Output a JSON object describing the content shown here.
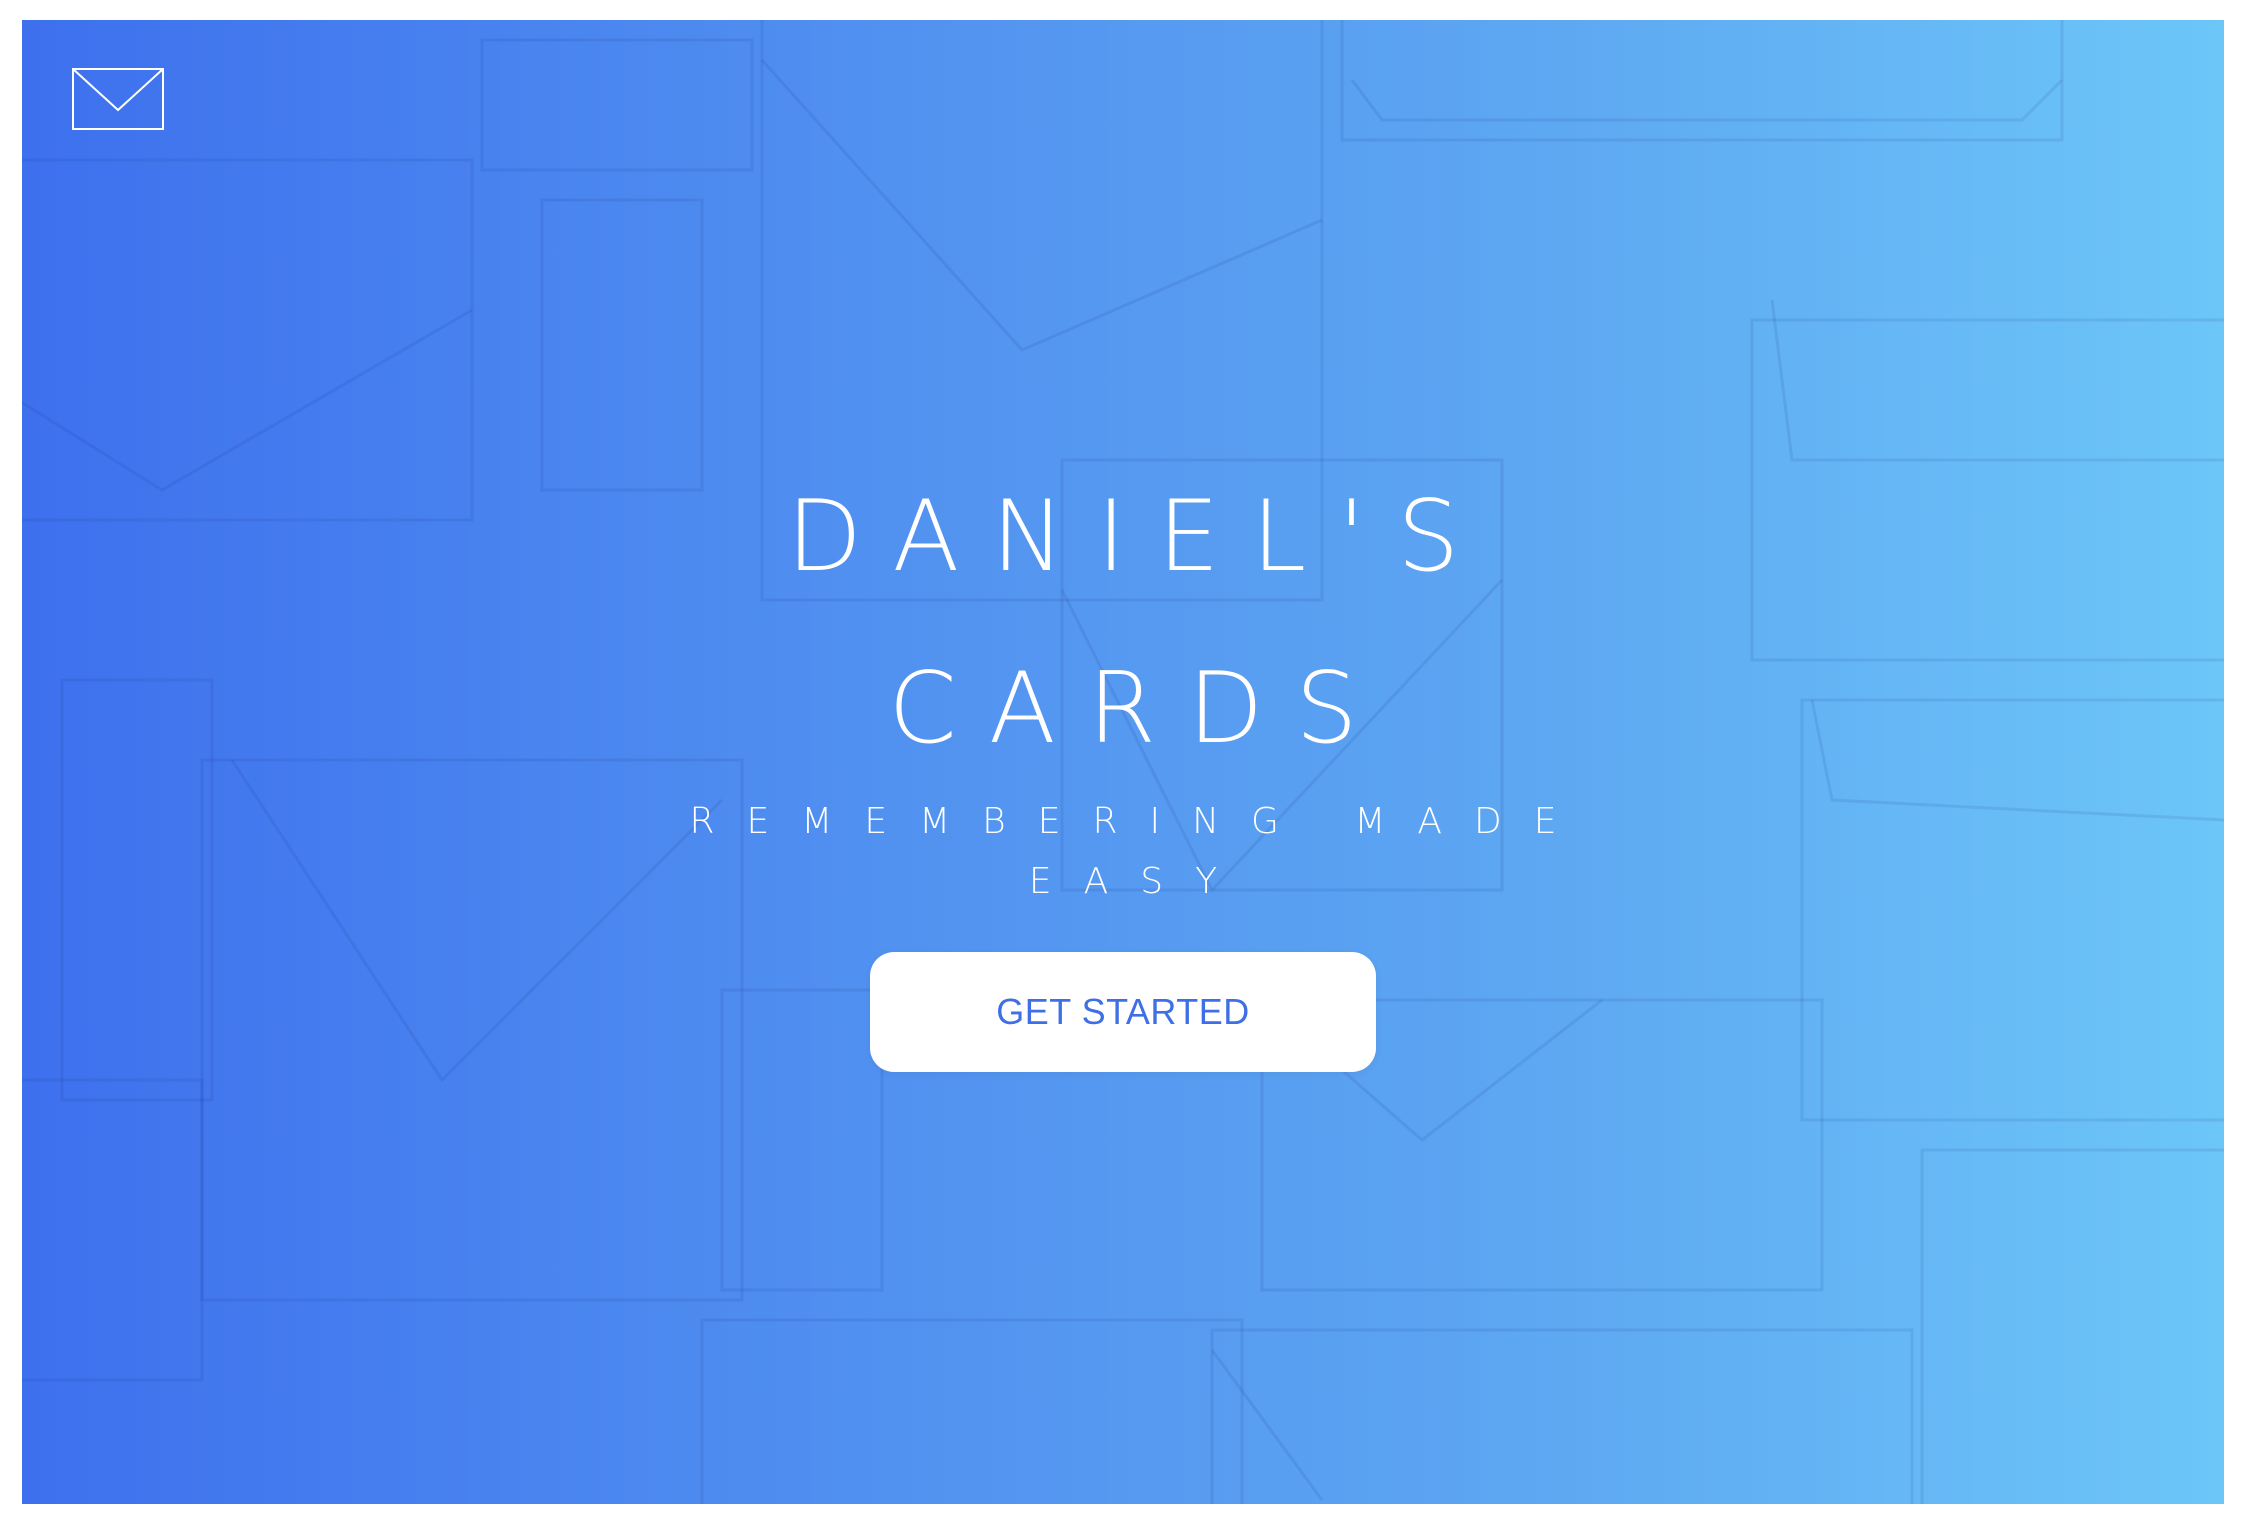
{
  "brand": {
    "logo_icon": "envelope-icon"
  },
  "hero": {
    "title_line1": "DANIEL'S",
    "title_line2": "CARDS",
    "tagline_line1": "REMEMBERING MADE",
    "tagline_line2": "EASY",
    "cta_label": "GET STARTED"
  },
  "colors": {
    "gradient_start": "#3e70ee",
    "gradient_end": "#6cc6f8",
    "cta_text": "#3f6fe6",
    "cta_background": "#ffffff"
  }
}
